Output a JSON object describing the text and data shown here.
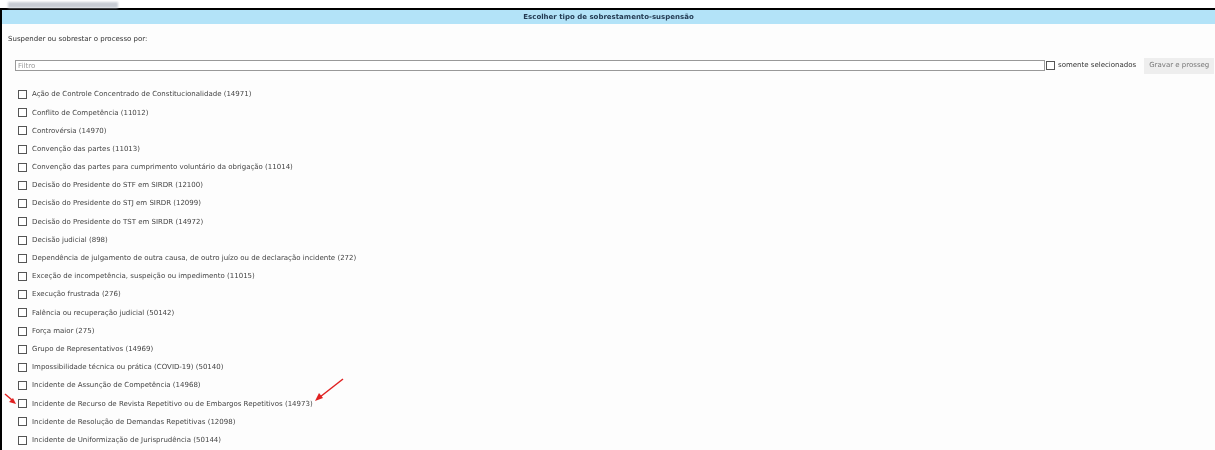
{
  "dialog": {
    "title": "Escolher tipo de sobrestamento-suspensão"
  },
  "prompt": "Suspender ou sobrestar o processo por:",
  "filter": {
    "placeholder": "Filtro",
    "only_selected": {
      "label": "somente selecionados",
      "checked": false
    },
    "save_button": "Gravar e prosseg"
  },
  "options": [
    {
      "label": "Ação de Controle Concentrado de Constitucionalidade (14971)",
      "checked": false
    },
    {
      "label": "Conflito de Competência (11012)",
      "checked": false
    },
    {
      "label": "Controvérsia (14970)",
      "checked": false
    },
    {
      "label": "Convenção das partes (11013)",
      "checked": false
    },
    {
      "label": "Convenção das partes para cumprimento voluntário da obrigação (11014)",
      "checked": false
    },
    {
      "label": "Decisão do Presidente do STF em SIRDR (12100)",
      "checked": false
    },
    {
      "label": "Decisão do Presidente do STJ em SIRDR (12099)",
      "checked": false
    },
    {
      "label": "Decisão do Presidente do TST em SIRDR (14972)",
      "checked": false
    },
    {
      "label": "Decisão judicial (898)",
      "checked": false
    },
    {
      "label": "Dependência de julgamento de outra causa, de outro juízo ou de declaração incidente (272)",
      "checked": false
    },
    {
      "label": "Exceção de incompetência, suspeição ou impedimento (11015)",
      "checked": false
    },
    {
      "label": "Execução frustrada (276)",
      "checked": false
    },
    {
      "label": "Falência ou recuperação judicial (50142)",
      "checked": false
    },
    {
      "label": "Força maior (275)",
      "checked": false
    },
    {
      "label": "Grupo de Representativos (14969)",
      "checked": false
    },
    {
      "label": "Impossibilidade técnica ou prática (COVID-19) (50140)",
      "checked": false
    },
    {
      "label": "Incidente de Assunção de Competência (14968)",
      "checked": false
    },
    {
      "label": "Incidente de Recurso de Revista Repetitivo ou de Embargos Repetitivos (14973)",
      "checked": false
    },
    {
      "label": "Incidente de Resolução de Demandas Repetitivas (12098)",
      "checked": false
    },
    {
      "label": "Incidente de Uniformização de Jurisprudência (50144)",
      "checked": false
    }
  ]
}
